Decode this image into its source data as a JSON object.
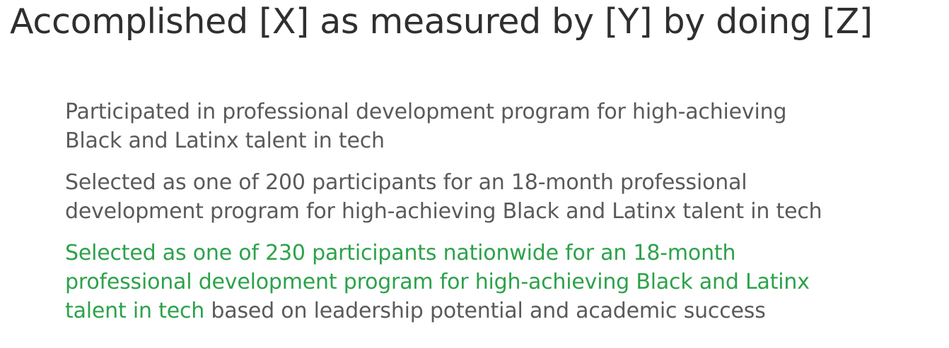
{
  "slide": {
    "title": "Accomplished [X] as measured by [Y] by doing [Z]"
  },
  "examples": [
    {
      "lines": [
        "Participated in professional development program for high-achieving",
        "Black and Latinx talent in tech"
      ]
    },
    {
      "lines": [
        "Selected as one of 200 participants for an 18-month professional",
        "development program for high-achieving Black and Latinx talent in tech"
      ]
    },
    {
      "highlight_lines": [
        "Selected as one of 230 participants nationwide for an 18-month",
        "professional development program for high-achieving Black and Latinx",
        "talent in tech"
      ],
      "rest": " based on leadership potential and academic success"
    }
  ],
  "colors": {
    "title": "#2f2f2f",
    "body_text": "#5a5a5a",
    "highlight": "#2ca24a"
  }
}
